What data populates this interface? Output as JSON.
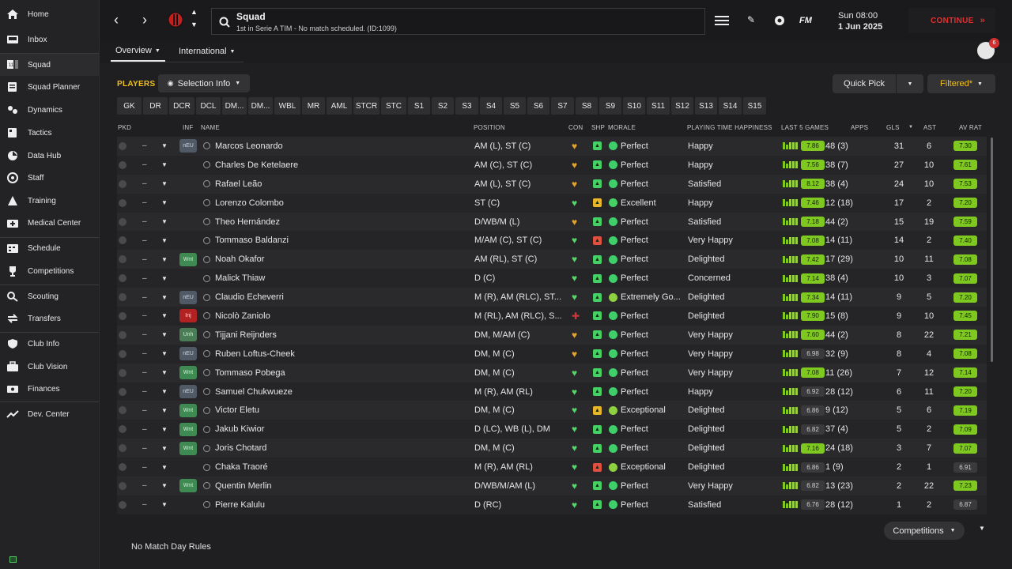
{
  "sidebar": [
    {
      "label": "Home",
      "icon": "home-icon"
    },
    {
      "label": "Inbox",
      "icon": "inbox-icon"
    },
    {
      "label": "Squad",
      "icon": "squad-icon"
    },
    {
      "label": "Squad Planner",
      "icon": "squad-planner-icon"
    },
    {
      "label": "Dynamics",
      "icon": "dynamics-icon"
    },
    {
      "label": "Tactics",
      "icon": "tactics-icon"
    },
    {
      "label": "Data Hub",
      "icon": "data-hub-icon"
    },
    {
      "label": "Staff",
      "icon": "staff-icon"
    },
    {
      "label": "Training",
      "icon": "training-icon"
    },
    {
      "label": "Medical Center",
      "icon": "medical-icon"
    },
    {
      "label": "Schedule",
      "icon": "schedule-icon"
    },
    {
      "label": "Competitions",
      "icon": "trophy-icon"
    },
    {
      "label": "Scouting",
      "icon": "scouting-icon"
    },
    {
      "label": "Transfers",
      "icon": "transfers-icon"
    },
    {
      "label": "Club Info",
      "icon": "shield-icon"
    },
    {
      "label": "Club Vision",
      "icon": "briefcase-icon"
    },
    {
      "label": "Finances",
      "icon": "finances-icon"
    },
    {
      "label": "Dev. Center",
      "icon": "dev-center-icon"
    }
  ],
  "topbar": {
    "title": "Squad",
    "subtitle": "1st in Serie A TIM - No match scheduled. (ID:1099)",
    "fm_label": "FM",
    "day_time": "Sun 08:00",
    "date": "1 Jun 2025",
    "continue_label": "CONTINUE",
    "notifications": "6"
  },
  "tabs": {
    "overview": "Overview",
    "international": "International"
  },
  "toolbar": {
    "players_label": "PLAYERS",
    "selection_info": "Selection Info",
    "quick_pick": "Quick Pick",
    "filtered": "Filtered*"
  },
  "positions": [
    "GK",
    "DR",
    "DCR",
    "DCL",
    "DM...",
    "DM...",
    "WBL",
    "MR",
    "AML",
    "STCR",
    "STC",
    "S1",
    "S2",
    "S3",
    "S4",
    "S5",
    "S6",
    "S7",
    "S8",
    "S9",
    "S10",
    "S11",
    "S12",
    "S13",
    "S14",
    "S15"
  ],
  "columns": {
    "pkd": "PKD",
    "inf": "INF",
    "name": "NAME",
    "position": "POSITION",
    "con": "CON",
    "shp": "SHP",
    "morale": "MORALE",
    "pth": "PLAYING TIME HAPPINESS",
    "last5": "LAST 5 GAMES",
    "apps": "APPS",
    "gls": "GLS",
    "ast": "AST",
    "avrat": "AV RAT"
  },
  "players": [
    {
      "name": "Marcos Leonardo",
      "position": "AM (L), ST (C)",
      "inf": "nEU",
      "con": "gold",
      "shp": "green",
      "morale": "Perfect",
      "happiness": "Happy",
      "last5": "7.86",
      "apps": "48 (3)",
      "gls": "31",
      "ast": "6",
      "avrat": "7.30"
    },
    {
      "name": "Charles De Ketelaere",
      "position": "AM (C), ST (C)",
      "inf": "",
      "con": "gold",
      "shp": "green",
      "morale": "Perfect",
      "happiness": "Happy",
      "last5": "7.56",
      "apps": "38 (7)",
      "gls": "27",
      "ast": "10",
      "avrat": "7.61"
    },
    {
      "name": "Rafael Leão",
      "position": "AM (L), ST (C)",
      "inf": "",
      "con": "gold",
      "shp": "green",
      "morale": "Perfect",
      "happiness": "Satisfied",
      "last5": "8.12",
      "apps": "38 (4)",
      "gls": "24",
      "ast": "10",
      "avrat": "7.53"
    },
    {
      "name": "Lorenzo Colombo",
      "position": "ST (C)",
      "inf": "",
      "con": "green",
      "shp": "yellow",
      "morale": "Excellent",
      "happiness": "Happy",
      "last5": "7.46",
      "apps": "12 (18)",
      "gls": "17",
      "ast": "2",
      "avrat": "7.20"
    },
    {
      "name": "Theo Hernández",
      "position": "D/WB/M (L)",
      "inf": "",
      "con": "gold",
      "shp": "green",
      "morale": "Perfect",
      "happiness": "Satisfied",
      "last5": "7.18",
      "apps": "44 (2)",
      "gls": "15",
      "ast": "19",
      "avrat": "7.59"
    },
    {
      "name": "Tommaso Baldanzi",
      "position": "M/AM (C), ST (C)",
      "inf": "",
      "con": "green",
      "shp": "red",
      "morale": "Perfect",
      "happiness": "Very Happy",
      "last5": "7.08",
      "apps": "14 (11)",
      "gls": "14",
      "ast": "2",
      "avrat": "7.40"
    },
    {
      "name": "Noah Okafor",
      "position": "AM (RL), ST (C)",
      "inf": "Wnt",
      "con": "green",
      "shp": "green",
      "morale": "Perfect",
      "happiness": "Delighted",
      "last5": "7.42",
      "apps": "17 (29)",
      "gls": "10",
      "ast": "11",
      "avrat": "7.08"
    },
    {
      "name": "Malick Thiaw",
      "position": "D (C)",
      "inf": "",
      "con": "green",
      "shp": "green",
      "morale": "Perfect",
      "happiness": "Concerned",
      "last5": "7.14",
      "apps": "38 (4)",
      "gls": "10",
      "ast": "3",
      "avrat": "7.07"
    },
    {
      "name": "Claudio Echeverri",
      "position": "M (R), AM (RLC), ST...",
      "inf": "nEU",
      "con": "green",
      "shp": "green",
      "morale": "Extremely Go...",
      "happiness": "Delighted",
      "last5": "7.34",
      "apps": "14 (11)",
      "gls": "9",
      "ast": "5",
      "avrat": "7.20"
    },
    {
      "name": "Nicolò Zaniolo",
      "position": "M (RL), AM (RLC), S...",
      "inf": "Inj",
      "con": "red",
      "shp": "green",
      "morale": "Perfect",
      "happiness": "Delighted",
      "last5": "7.90",
      "apps": "15 (8)",
      "gls": "9",
      "ast": "10",
      "avrat": "7.45"
    },
    {
      "name": "Tijjani Reijnders",
      "position": "DM, M/AM (C)",
      "inf": "Unh",
      "con": "gold",
      "shp": "green",
      "morale": "Perfect",
      "happiness": "Very Happy",
      "last5": "7.60",
      "apps": "44 (2)",
      "gls": "8",
      "ast": "22",
      "avrat": "7.21"
    },
    {
      "name": "Ruben Loftus-Cheek",
      "position": "DM, M (C)",
      "inf": "nEU",
      "con": "gold",
      "shp": "green",
      "morale": "Perfect",
      "happiness": "Very Happy",
      "last5": "6.98",
      "apps": "32 (9)",
      "gls": "8",
      "ast": "4",
      "avrat": "7.08"
    },
    {
      "name": "Tommaso Pobega",
      "position": "DM, M (C)",
      "inf": "Wnt",
      "con": "green",
      "shp": "green",
      "morale": "Perfect",
      "happiness": "Very Happy",
      "last5": "7.08",
      "apps": "11 (26)",
      "gls": "7",
      "ast": "12",
      "avrat": "7.14"
    },
    {
      "name": "Samuel Chukwueze",
      "position": "M (R), AM (RL)",
      "inf": "nEU",
      "con": "green",
      "shp": "green",
      "morale": "Perfect",
      "happiness": "Happy",
      "last5": "6.92",
      "apps": "28 (12)",
      "gls": "6",
      "ast": "11",
      "avrat": "7.20"
    },
    {
      "name": "Victor Eletu",
      "position": "DM, M (C)",
      "inf": "Wnt",
      "con": "green",
      "shp": "yellow",
      "morale": "Exceptional",
      "happiness": "Delighted",
      "last5": "6.86",
      "apps": "9 (12)",
      "gls": "5",
      "ast": "6",
      "avrat": "7.19"
    },
    {
      "name": "Jakub Kiwior",
      "position": "D (LC), WB (L), DM",
      "inf": "Wnt",
      "con": "green",
      "shp": "green",
      "morale": "Perfect",
      "happiness": "Delighted",
      "last5": "6.82",
      "apps": "37 (4)",
      "gls": "5",
      "ast": "2",
      "avrat": "7.09"
    },
    {
      "name": "Joris Chotard",
      "position": "DM, M (C)",
      "inf": "Wnt",
      "con": "green",
      "shp": "green",
      "morale": "Perfect",
      "happiness": "Delighted",
      "last5": "7.16",
      "apps": "24 (18)",
      "gls": "3",
      "ast": "7",
      "avrat": "7.07"
    },
    {
      "name": "Chaka Traoré",
      "position": "M (R), AM (RL)",
      "inf": "",
      "con": "green",
      "shp": "red",
      "morale": "Exceptional",
      "happiness": "Delighted",
      "last5": "6.86",
      "apps": "1 (9)",
      "gls": "2",
      "ast": "1",
      "avrat": "6.91"
    },
    {
      "name": "Quentin Merlin",
      "position": "D/WB/M/AM (L)",
      "inf": "Wnt",
      "con": "green",
      "shp": "green",
      "morale": "Perfect",
      "happiness": "Very Happy",
      "last5": "6.82",
      "apps": "13 (23)",
      "gls": "2",
      "ast": "22",
      "avrat": "7.23"
    },
    {
      "name": "Pierre Kalulu",
      "position": "D (RC)",
      "inf": "",
      "con": "green",
      "shp": "green",
      "morale": "Perfect",
      "happiness": "Satisfied",
      "last5": "6.76",
      "apps": "28 (12)",
      "gls": "1",
      "ast": "2",
      "avrat": "6.87"
    }
  ],
  "footer": {
    "competitions": "Competitions",
    "no_match": "No Match Day Rules"
  },
  "colors": {
    "accent_red": "#e03030",
    "players_gold": "#f0c020",
    "rating_green": "#7ec81f",
    "perfect_green": "#3fcf6a"
  }
}
